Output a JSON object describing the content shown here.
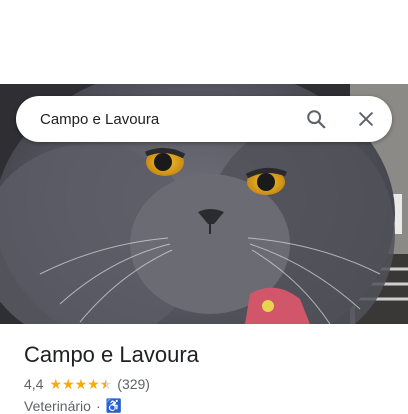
{
  "search": {
    "query": "Campo e Lavoura"
  },
  "place": {
    "name": "Campo e Lavoura",
    "rating": "4,4",
    "stars_value": 4.4,
    "reviews": "(329)",
    "category": "Veterinário",
    "separator": "·"
  },
  "icons": {
    "search": "search-icon",
    "close": "close-icon",
    "wheelchair": "wheelchair-accessible-icon"
  },
  "colors": {
    "star": "#f9ab00",
    "title": "#202124",
    "secondary": "#5f6368",
    "accessibility": "#1a73e8"
  }
}
